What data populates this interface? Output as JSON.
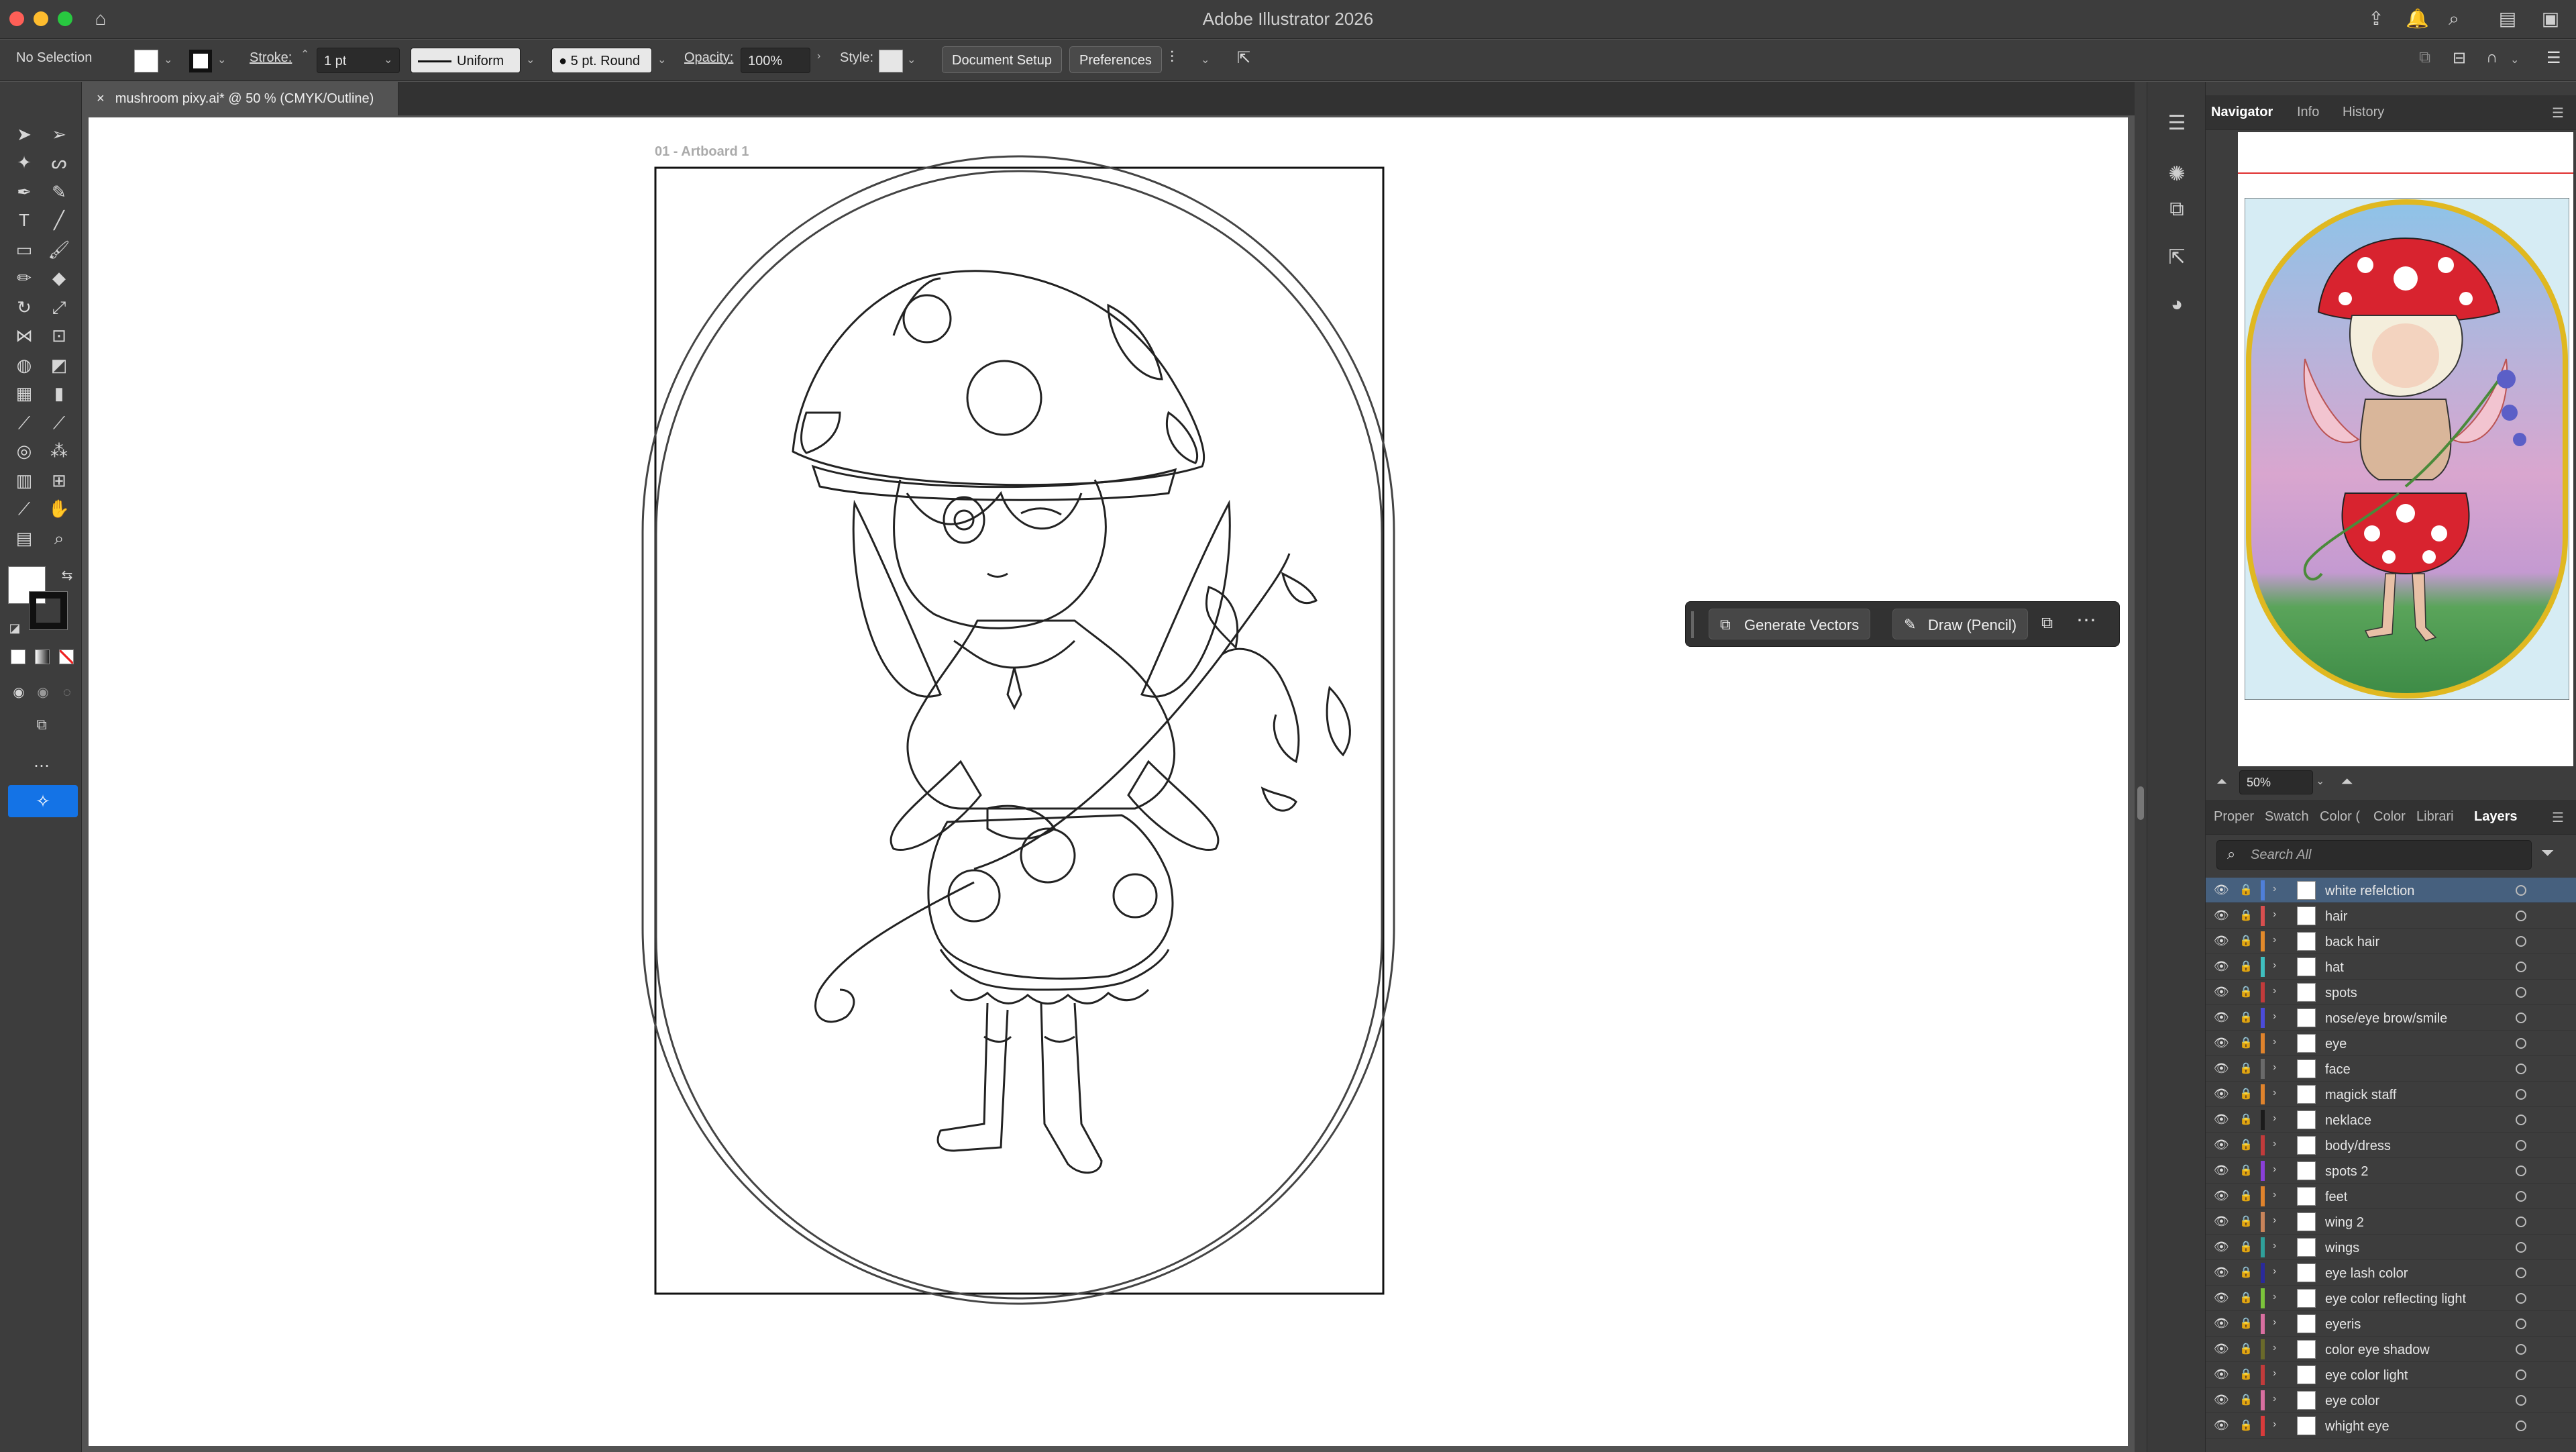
{
  "app": {
    "title": "Adobe Illustrator 2026"
  },
  "control_bar": {
    "selection": "No Selection",
    "stroke_label": "Stroke:",
    "stroke_weight": "1 pt",
    "variable_width": "Uniform",
    "brush": "5 pt. Round",
    "opacity_label": "Opacity:",
    "opacity_value": "100%",
    "style_label": "Style:",
    "document_setup": "Document Setup",
    "preferences": "Preferences"
  },
  "document": {
    "tab_title": "mushroom pixy.ai* @ 50 % (CMYK/Outline)",
    "artboard_label": "01 - Artboard 1"
  },
  "contextual_bar": {
    "generate_vectors": "Generate Vectors",
    "draw_pencil": "Draw (Pencil)"
  },
  "panels": {
    "top_tabs": [
      {
        "label": "Navigator",
        "active": true
      },
      {
        "label": "Info",
        "active": false
      },
      {
        "label": "History",
        "active": false
      }
    ],
    "zoom": "50%",
    "bottom_tabs": [
      {
        "label": "Proper",
        "active": false
      },
      {
        "label": "Swatch",
        "active": false
      },
      {
        "label": "Color (",
        "active": false
      },
      {
        "label": "Color",
        "active": false
      },
      {
        "label": "Librari",
        "active": false
      },
      {
        "label": "Layers",
        "active": true
      }
    ],
    "search_placeholder": "Search All"
  },
  "layers": [
    {
      "name": "white refelction",
      "color": "#4f7fd9",
      "selected": true
    },
    {
      "name": "hair",
      "color": "#d94f4f"
    },
    {
      "name": "back hair",
      "color": "#e28a2b"
    },
    {
      "name": "hat",
      "color": "#3fbfbf"
    },
    {
      "name": "spots",
      "color": "#c23b3b"
    },
    {
      "name": "nose/eye brow/smile",
      "color": "#4b4bd9"
    },
    {
      "name": "eye",
      "color": "#e0832c"
    },
    {
      "name": "face",
      "color": "#6a6a6a"
    },
    {
      "name": "magick staff",
      "color": "#e0832c"
    },
    {
      "name": "neklace",
      "color": "#1b1b1b"
    },
    {
      "name": "body/dress",
      "color": "#c23b3b"
    },
    {
      "name": "spots 2",
      "color": "#8a3fd9"
    },
    {
      "name": "feet",
      "color": "#e0832c"
    },
    {
      "name": "wing 2",
      "color": "#c9845a"
    },
    {
      "name": "wings",
      "color": "#2fa09a"
    },
    {
      "name": "eye lash color",
      "color": "#2a2a9a"
    },
    {
      "name": "eye color reflecting light",
      "color": "#7cc43b"
    },
    {
      "name": "eyeris",
      "color": "#d96fa0"
    },
    {
      "name": "color eye shadow",
      "color": "#6a6a2a"
    },
    {
      "name": "eye color light",
      "color": "#c23b3b"
    },
    {
      "name": "eye color",
      "color": "#d96fa0"
    },
    {
      "name": "whight eye",
      "color": "#d93b3b"
    }
  ]
}
